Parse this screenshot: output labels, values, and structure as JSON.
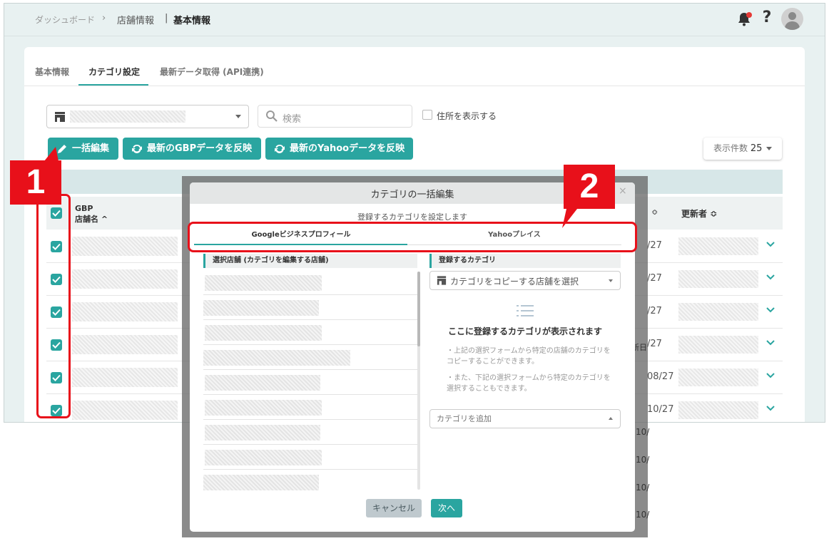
{
  "breadcrumb": {
    "home": "ダッシュボード",
    "sep": "›",
    "section": "店舗情報",
    "bar": "|",
    "current": "基本情報"
  },
  "tabs": [
    "基本情報",
    "カテゴリ設定",
    "最新データ取得 (API連携)"
  ],
  "search": {
    "placeholder": "検索"
  },
  "show_address": "住所を表示する",
  "buttons": {
    "bulk_edit": "一括編集",
    "reflect_gbp": "最新のGBPデータを反映",
    "reflect_yahoo": "最新のYahooデータを反映"
  },
  "per_page": {
    "label": "表示件数",
    "value": "25"
  },
  "table": {
    "col_gbp": "GBP",
    "col_store": "店舗名 ^",
    "col_sort": "≎",
    "col_updater": "更新者 ≎",
    "dates": [
      "/27",
      "/27",
      "/27",
      "/27",
      "08/27",
      "10/27"
    ],
    "behind_text": [
      "10/",
      "10/",
      "10/",
      "10/"
    ],
    "behind_header": "新日"
  },
  "badges": {
    "one": "1",
    "two": "2"
  },
  "modal": {
    "title": "カテゴリの一括編集",
    "close": "×",
    "subtitle": "登録するカテゴリを設定します",
    "tab_google": "Googleビジネスプロフィール",
    "tab_yahoo": "Yahooプレイス",
    "left_header": "選択店舗 (カテゴリを編集する店舗)",
    "right_header": "登録するカテゴリ",
    "copy_select": "カテゴリをコピーする店舗を選択",
    "empty_title": "ここに登録するカテゴリが表示されます",
    "note1": "・上記の選択フォームから特定の店舗のカテゴリを コピーすることができます。",
    "note2": "・また、下記の選択フォームから特定のカテゴリを 選択することもできます。",
    "add_category": "カテゴリを追加",
    "cancel": "キャンセル",
    "next": "次へ"
  },
  "colors": {
    "accent": "#2aa5a0",
    "annotation": "#e8101a"
  }
}
